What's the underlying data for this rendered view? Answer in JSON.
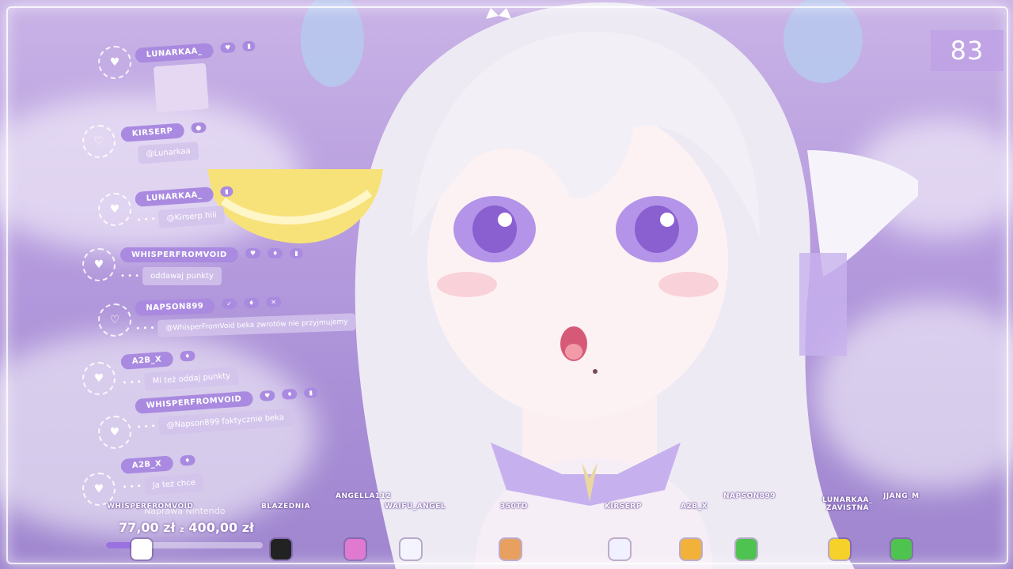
{
  "counter": "83",
  "chat": [
    {
      "user": "LUNARKAA_",
      "badges": [
        "♥",
        "▮"
      ],
      "message": "",
      "sticker": true
    },
    {
      "user": "KIRSERP",
      "badges": [
        "●"
      ],
      "message": "@Lunarkaa"
    },
    {
      "user": "LUNARKAA_",
      "badges": [
        "▮"
      ],
      "message": "@Kirserp hiii"
    },
    {
      "user": "WHISPERFROMVOID",
      "badges": [
        "♥",
        "♦",
        "▮"
      ],
      "message": "oddawaj punkty"
    },
    {
      "user": "NAPSON899",
      "badges": [
        "✓",
        "♦",
        "✕"
      ],
      "message": "@WhisperFromVoid beka zwrotów nie przyjmujemy"
    },
    {
      "user": "A2B_X",
      "badges": [
        "♦"
      ],
      "message": "Mi też oddaj punkty"
    },
    {
      "user": "WHISPERFROMVOID",
      "badges": [
        "♥",
        "♦",
        "▮"
      ],
      "message": "@Napson899 faktycznie beka"
    },
    {
      "user": "A2B_X",
      "badges": [
        "♦"
      ],
      "message": "Ja też chce"
    }
  ],
  "goal": {
    "title": "Naprawa Nintendo",
    "current": "77,00 zł",
    "separator": "z",
    "target": "400,00 zł",
    "progress": 0.19
  },
  "viewers": [
    {
      "name": "WHISPERFROMVOID",
      "color": "#ffffff"
    },
    {
      "name": "BLAZEDNIA",
      "color": "#222222"
    },
    {
      "name": "ANGELLA112",
      "color": "#e07ad0"
    },
    {
      "name": "WAIFU_ANGEL",
      "color": "#f4f4ff"
    },
    {
      "name": "350TD",
      "color": "#e8a060"
    },
    {
      "name": "KIRSERP",
      "color": "#f0f0ff"
    },
    {
      "name": "A2B_X",
      "color": "#f2b23a"
    },
    {
      "name": "NAPSON899",
      "color": "#4fc34f"
    },
    {
      "name": "LUNARKAA_ ZAVISTNA",
      "color": "#f5d12a"
    },
    {
      "name": "JJANG_M",
      "color": "#4fc34f"
    }
  ],
  "colors": {
    "accent": "#a98ae0",
    "background": "#b79ddf"
  }
}
